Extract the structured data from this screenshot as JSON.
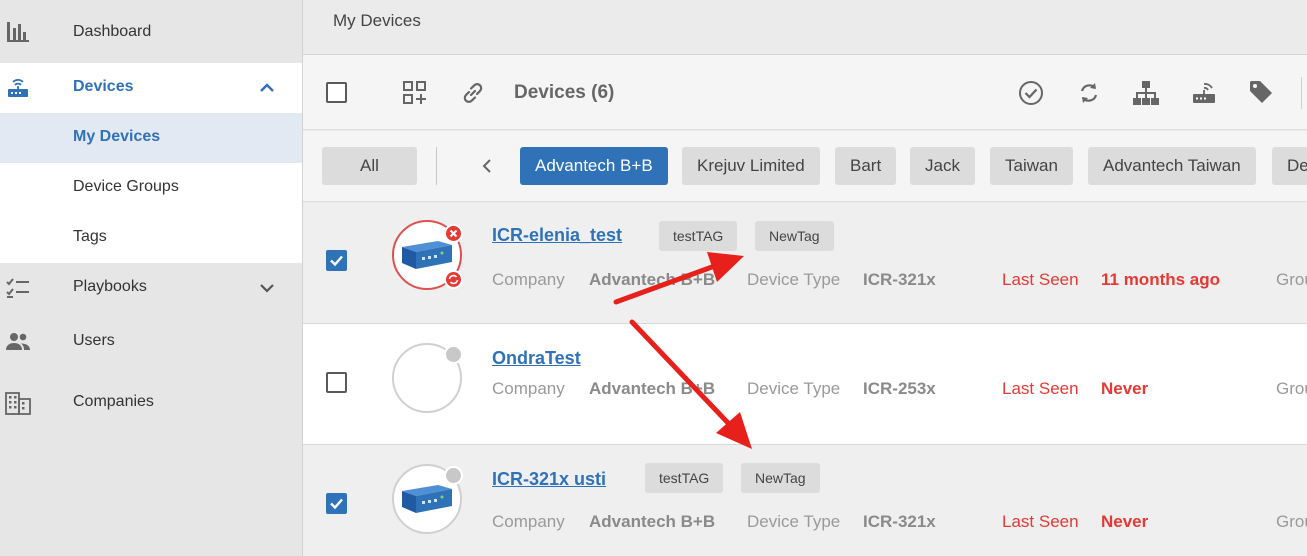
{
  "sidebar": {
    "items": [
      {
        "label": "Dashboard",
        "icon": "bar-chart-icon"
      },
      {
        "label": "Devices",
        "icon": "router-icon",
        "active": true
      },
      {
        "label": "Playbooks",
        "icon": "checklist-icon"
      },
      {
        "label": "Users",
        "icon": "users-icon"
      },
      {
        "label": "Companies",
        "icon": "building-icon"
      }
    ],
    "sub_items": [
      {
        "label": "My Devices",
        "active": true
      },
      {
        "label": "Device Groups"
      },
      {
        "label": "Tags"
      }
    ]
  },
  "header": {
    "breadcrumb": "My Devices"
  },
  "toolbar": {
    "title": "Devices (6)",
    "icons": [
      "select-all-checkbox",
      "add-grid-icon",
      "link-icon",
      "check-circle-icon",
      "sync-icon",
      "hierarchy-icon",
      "router-icon",
      "tag-icon"
    ]
  },
  "filters": {
    "all_label": "All",
    "companies": [
      "Advantech B+B",
      "Krejuv Limited",
      "Bart",
      "Jack",
      "Taiwan",
      "Advantech Taiwan",
      "De"
    ],
    "active_company": "Advantech B+B"
  },
  "labels": {
    "company": "Company",
    "device_type": "Device Type",
    "last_seen": "Last Seen",
    "group": "Grou"
  },
  "devices": [
    {
      "name": "ICR-elenia_test",
      "tags": [
        "testTAG",
        "NewTag"
      ],
      "company": "Advantech B+B",
      "device_type": "ICR-321x",
      "last_seen": "11 months ago",
      "checked": true
    },
    {
      "name": "OndraTest",
      "tags": [],
      "company": "Advantech B+B",
      "device_type": "ICR-253x",
      "last_seen": "Never",
      "checked": false
    },
    {
      "name": "ICR-321x usti",
      "tags": [
        "testTAG",
        "NewTag"
      ],
      "company": "Advantech B+B",
      "device_type": "ICR-321x",
      "last_seen": "Never",
      "checked": true
    }
  ],
  "colors": {
    "accent": "#2f72b8",
    "danger": "#e53935",
    "arrow": "#e8201c"
  }
}
